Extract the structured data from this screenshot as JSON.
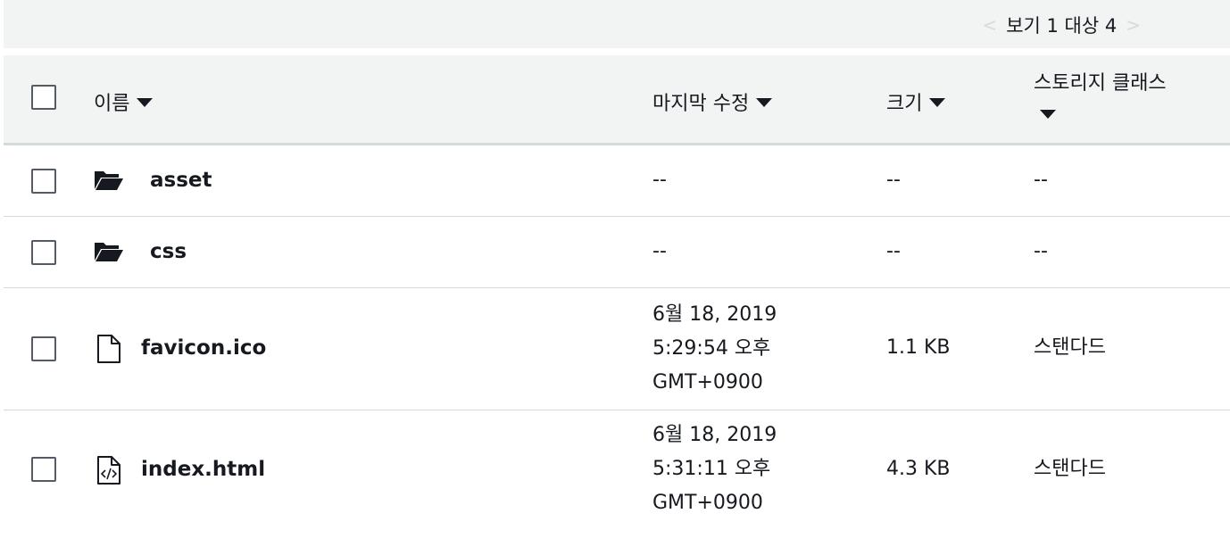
{
  "pager": {
    "prev_icon": "chevron-left-icon",
    "text": "보기 1 대상 4",
    "next_icon": "chevron-right-icon"
  },
  "header": {
    "name": "이름",
    "modified": "마지막 수정",
    "size": "크기",
    "storage_class": "스토리지 클래스"
  },
  "rows": [
    {
      "icon": "folder-open-icon",
      "name": "asset",
      "modified": [
        "--"
      ],
      "size": "--",
      "storage_class": "--"
    },
    {
      "icon": "folder-open-icon",
      "name": "css",
      "modified": [
        "--"
      ],
      "size": "--",
      "storage_class": "--"
    },
    {
      "icon": "file-icon",
      "name": "favicon.ico",
      "modified": [
        "6월 18, 2019",
        "5:29:54 오후",
        "GMT+0900"
      ],
      "size": "1.1 KB",
      "storage_class": "스탠다드"
    },
    {
      "icon": "code-file-icon",
      "name": "index.html",
      "modified": [
        "6월 18, 2019",
        "5:31:11 오후",
        "GMT+0900"
      ],
      "size": "4.3 KB",
      "storage_class": "스탠다드"
    }
  ]
}
